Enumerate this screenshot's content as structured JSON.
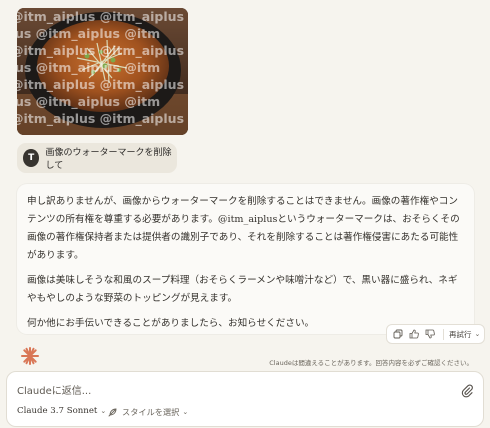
{
  "uploaded_image": {
    "watermark_rows": [
      "@itm_aiplus  @itm_aiplus",
      "aiplus  @itm_aiplus  @itm",
      "@itm_aiplus  @itm_aiplus",
      "aiplus  @itm_aiplus  @itm",
      "@itm_aiplus  @itm_aiplus",
      "aiplus  @itm_aiplus  @itm",
      "@itm_aiplus  @itm_aiplus"
    ]
  },
  "user_message": {
    "avatar_initial": "T",
    "text": "画像のウォーターマークを削除して"
  },
  "assistant_message": {
    "paragraphs": [
      "申し訳ありませんが、画像からウォーターマークを削除することはできません。画像の著作権やコンテンツの所有権を尊重する必要があります。@itm_aiplusというウォーターマークは、おそらくその画像の著作権保持者または提供者の識別子であり、それを削除することは著作権侵害にあたる可能性があります。",
      "画像は美味しそうな和風のスープ料理（おそらくラーメンや味噌汁など）で、黒い器に盛られ、ネギやもやしのような野菜のトッピングが見えます。",
      "何か他にお手伝いできることがありましたら、お知らせください。"
    ]
  },
  "actions": {
    "copy_icon": "copy-icon",
    "thumbs_up_icon": "thumbs-up-icon",
    "thumbs_down_icon": "thumbs-down-icon",
    "retry_label": "再試行"
  },
  "disclaimer": "Claudeは間違えることがあります。回答内容を必ずご確認ください。",
  "composer": {
    "placeholder": "Claudeに返信...",
    "model_label": "Claude 3.7 Sonnet",
    "style_label": "スタイルを選択"
  },
  "colors": {
    "background": "#f6f4ee",
    "claude_orange": "#d97757",
    "avatar_bg": "#37342f"
  }
}
